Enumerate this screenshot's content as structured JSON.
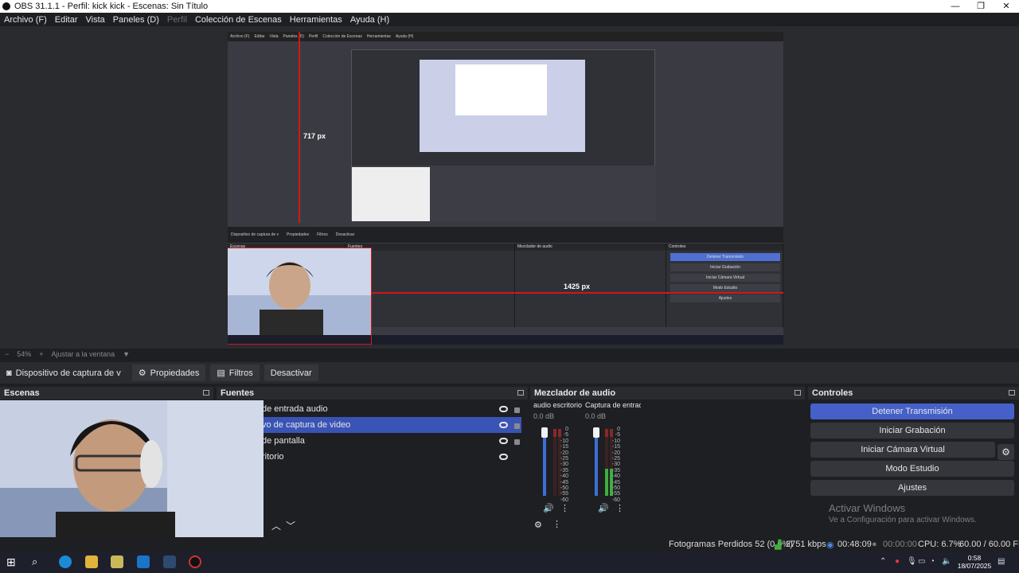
{
  "window": {
    "title": "OBS 31.1.1 - Perfil: kick kick - Escenas: Sin Título"
  },
  "menu": {
    "items": [
      "Archivo (F)",
      "Editar",
      "Vista",
      "Paneles (D)",
      "Perfil",
      "Colección de Escenas",
      "Herramientas",
      "Ayuda (H)"
    ],
    "disabled_index": 4
  },
  "preview": {
    "label_v": "717 px",
    "label_h": "1425 px"
  },
  "zoom": {
    "percent": "54%",
    "fit_label": "Ajustar a la ventana"
  },
  "source_toolbar": {
    "source_name": "Dispositivo de captura de v",
    "properties": "Propiedades",
    "filters": "Filtros",
    "deactivate": "Desactivar"
  },
  "docks": {
    "scenes": {
      "title": "Escenas"
    },
    "sources": {
      "title": "Fuentes",
      "items": [
        {
          "name": "de entrada audio",
          "selected": false
        },
        {
          "name": "vo de captura de video",
          "selected": true
        },
        {
          "name": "de pantalla",
          "selected": false
        },
        {
          "name": "ritorio",
          "selected": false
        }
      ]
    },
    "mixer": {
      "title": "Mezclador de audio",
      "channels": [
        {
          "name": "audio escritorio",
          "db": "0.0 dB",
          "level": 0.0
        },
        {
          "name": "Captura de entrad",
          "db": "0.0 dB",
          "level": 0.4
        }
      ],
      "scale": [
        "0",
        "-5",
        "-10",
        "-15",
        "-20",
        "-25",
        "-30",
        "-35",
        "-40",
        "-45",
        "-50",
        "-55",
        "-60"
      ]
    },
    "controls": {
      "title": "Controles",
      "buttons": [
        "Detener Transmisión",
        "Iniciar Grabación",
        "Iniciar Cámara Virtual",
        "Modo Estudio",
        "Ajustes"
      ]
    }
  },
  "activate_windows": {
    "title": "Activar Windows",
    "subtitle": "Ve a Configuración para activar Windows."
  },
  "status": {
    "dropped": "Fotogramas Perdidos 52 (0.0%)",
    "kbps": "2751 kbps",
    "stream_time": "00:48:09",
    "rec_time": "00:00:00",
    "cpu": "CPU: 6.7%",
    "fps": "60.00 / 60.00 FPS"
  },
  "taskbar": {
    "time": "0:58",
    "date": "18/07/2025"
  },
  "colors": {
    "accent": "#4561c9",
    "marker": "#d01818",
    "bg": "#1e1f23"
  }
}
